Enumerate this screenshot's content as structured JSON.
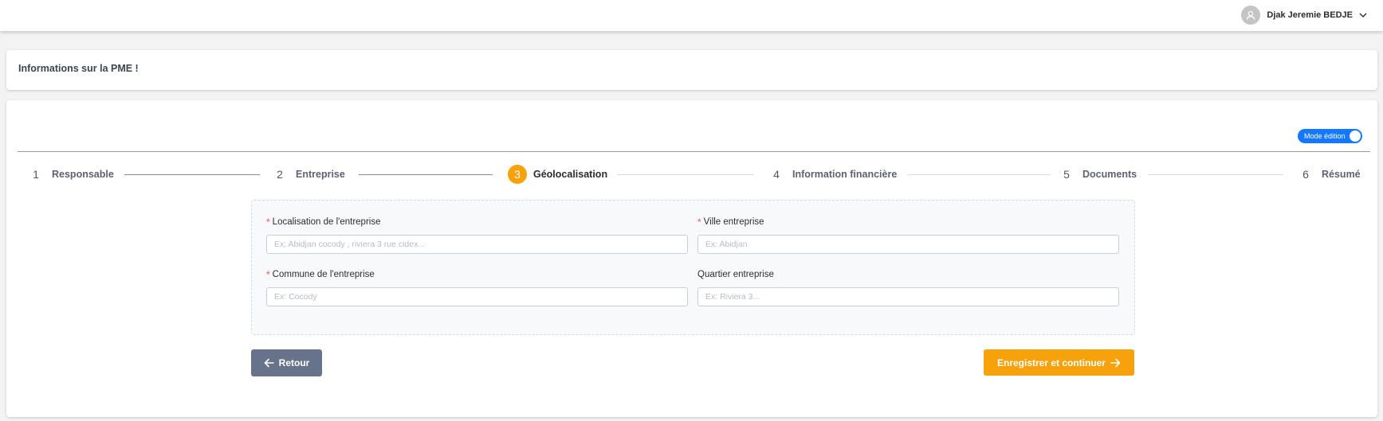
{
  "user": {
    "name": "Djak Jeremie BEDJE",
    "avatar_icon": "user-icon",
    "menu_icon": "chevron-down-icon"
  },
  "page": {
    "title": "Informations sur la PME !"
  },
  "toggle": {
    "label": "Mode édition",
    "state": "on",
    "color": "#1677ff"
  },
  "stepper": {
    "current": 3,
    "steps": [
      {
        "num": "1",
        "label": "Responsable"
      },
      {
        "num": "2",
        "label": "Entreprise"
      },
      {
        "num": "3",
        "label": "Géolocalisation"
      },
      {
        "num": "4",
        "label": "Information financière"
      },
      {
        "num": "5",
        "label": "Documents"
      },
      {
        "num": "6",
        "label": "Résumé"
      }
    ],
    "active_color": "#f7a10b"
  },
  "form": {
    "required_mark": "*",
    "fields": [
      {
        "label": "Localisation de l'entreprise",
        "required": true,
        "value": "",
        "placeholder": "Ex: Abidjan cocody , riviera 3 rue cidex..."
      },
      {
        "label": "Ville entreprise",
        "required": true,
        "value": "",
        "placeholder": "Ex: Abidjan"
      },
      {
        "label": "Commune de l'entreprise",
        "required": true,
        "value": "",
        "placeholder": "Ex: Cocody"
      },
      {
        "label": "Quartier entreprise",
        "required": false,
        "value": "",
        "placeholder": "Ex: Riviera 3..."
      }
    ]
  },
  "actions": {
    "back_label": "Retour",
    "back_icon": "arrow-left-icon",
    "next_label": "Enregistrer et continuer",
    "next_icon": "arrow-right-icon",
    "back_color": "#66738a",
    "next_color": "#f7a10b"
  }
}
